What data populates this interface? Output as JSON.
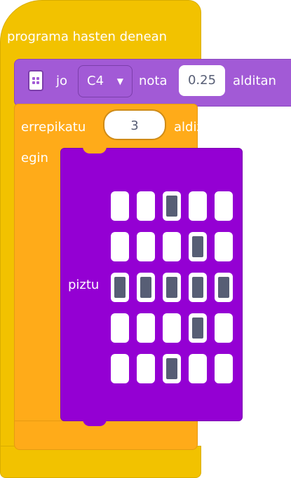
{
  "hat": {
    "label": "programa hasten denean"
  },
  "music": {
    "jo_label": "jo",
    "note": "C4",
    "nota_label": "nota",
    "beats": "0.25",
    "alditan_label": "alditan"
  },
  "repeat": {
    "label": "errepikatu",
    "count": "3",
    "times_label": "aldiz",
    "do_label": "egin"
  },
  "led": {
    "label": "piztu",
    "matrix": [
      [
        0,
        0,
        1,
        0,
        0
      ],
      [
        0,
        0,
        0,
        1,
        0
      ],
      [
        1,
        1,
        1,
        1,
        1
      ],
      [
        0,
        0,
        0,
        1,
        0
      ],
      [
        0,
        0,
        1,
        0,
        0
      ]
    ]
  },
  "colors": {
    "hat": "#f2c200",
    "music": "#a25ad6",
    "repeat": "#ffab19",
    "led": "#9400d3"
  }
}
